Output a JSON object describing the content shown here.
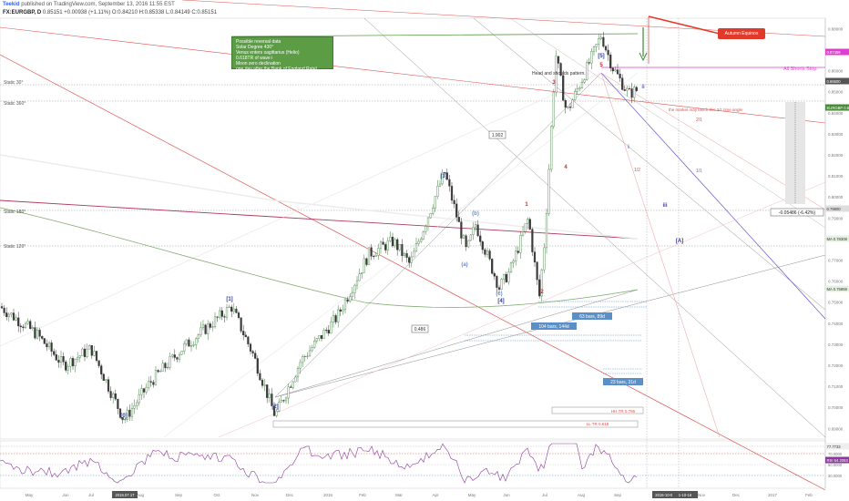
{
  "header": {
    "publisher": "Teekid",
    "published_text": "published on TradingView.com, September 13, 2016 11:55 EST",
    "symbol": "FX:EURGBP, D",
    "price": "0.85151",
    "change": "+0.00938 (+1.11%)",
    "open": "O:0.84210",
    "high": "H:0.85338",
    "low": "L:0.84149",
    "close": "C:0.85151"
  },
  "annotations": {
    "note_lines": [
      "Possible reversal data",
      "Solar Degree 430°",
      "Venus enters sagittarius (Helio)",
      "0.618TR of wave i",
      "Moon zero declination",
      "one day after the  Bank of England Rate)"
    ],
    "equinox": "Autumn Equinox",
    "all_shorts_stop": "All Shorts Stop.",
    "head_shoulders": "Head and shoulds pattern.",
    "time_angle": "the market may touch this 2/1 time angle",
    "static_30": "Static 30°",
    "static_360": "Static 360°",
    "static_180": "Static 180°",
    "static_120": "Static 120°",
    "ratio_1902": "1.902",
    "ratio_0486": "0.486",
    "range_63": "63 bars, 89d",
    "range_104": "104 bars, 144d",
    "range_23": "23 bars, 31d",
    "hh_tr": "HH TR 0.786",
    "ll_tr": "LL TR 0.618",
    "measure": "-0.05486 (-6.42%)",
    "angle_21": "2/1",
    "angle_11": "1/1",
    "angle_12": "1/2"
  },
  "waves": {
    "w0": "[0]",
    "w1": "[1]",
    "w2": "[2]",
    "w3": "[3]",
    "w4": "[4]",
    "w5": "[5]",
    "r1": "1",
    "r2": "2",
    "r3": "3",
    "r4": "4",
    "r5": "5",
    "sa": "(a)",
    "sb": "(b)",
    "sc": "(c)",
    "ri": "i",
    "rii": "ii",
    "riii": "iii",
    "bigA": "[A]"
  },
  "price_axis": {
    "labels": [
      "0.88000",
      "0.87000",
      "0.86000",
      "0.85000",
      "0.84000",
      "0.83000",
      "0.82000",
      "0.81000",
      "0.80000",
      "0.79000",
      "0.78000",
      "0.77000",
      "0.76000",
      "0.75000",
      "0.74000",
      "0.73000",
      "0.72000",
      "0.71000",
      "0.70000",
      "0.69000"
    ],
    "tag_top": "0.87459",
    "tag_mid": "0.86600",
    "tag_last": "EURGBP 0.85151",
    "tag_s180": "0.79800",
    "tag_ma1": "MA 0.78308",
    "tag_ma2": "MA 0.75859"
  },
  "rsi": {
    "label": "RSI 54.2083",
    "level_high": "77.7733",
    "level_70": "70.0000",
    "level_50": "50.0000",
    "level_30": "30.0000"
  },
  "time_axis": {
    "labels": [
      "May",
      "Jun",
      "Jul",
      "2015.07.17",
      "Aug",
      "Sep",
      "Oct",
      "Nov",
      "Dec",
      "2016",
      "Feb",
      "Mar",
      "Apr",
      "May",
      "Jun",
      "Jul",
      "Aug",
      "Sep",
      "2016-10-05",
      "1-10-16",
      "Nov",
      "Dec",
      "2017",
      "Feb"
    ]
  },
  "colors": {
    "background": "#ffffff",
    "candle_up": "#3a7d3a",
    "candle_down": "#3a3a3a",
    "wave_blue": "#2c3e91",
    "wave_red": "#c8302a",
    "note_green": "#5b9c45",
    "magenta": "#e03cd0",
    "equinox_red": "#e23a2a",
    "range_blue": "#5b8fc8"
  },
  "chart_data": {
    "type": "line",
    "title": "",
    "xlabel": "",
    "ylabel": "",
    "series": [
      {
        "name": "EURGBP",
        "x": [
          "2015-05",
          "2015-06",
          "2015-07",
          "2015-07-17",
          "2015-08",
          "2015-09",
          "2015-10",
          "2015-11",
          "2015-12",
          "2016-01",
          "2016-02",
          "2016-03",
          "2016-04",
          "2016-05",
          "2016-06",
          "2016-07",
          "2016-08",
          "2016-09"
        ],
        "values": [
          0.716,
          0.725,
          0.712,
          0.701,
          0.719,
          0.735,
          0.723,
          0.703,
          0.722,
          0.748,
          0.768,
          0.785,
          0.812,
          0.777,
          0.758,
          0.868,
          0.877,
          0.852
        ]
      }
    ],
    "ylim": [
      0.685,
      0.885
    ],
    "legend": "none",
    "grid": false
  }
}
